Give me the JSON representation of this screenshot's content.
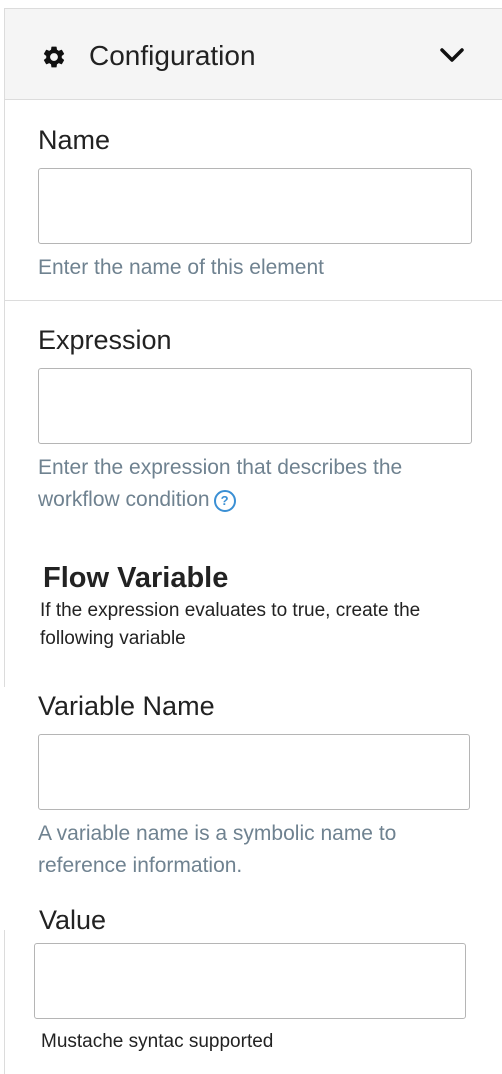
{
  "header": {
    "title": "Configuration"
  },
  "name_field": {
    "label": "Name",
    "help": "Enter the name of this element"
  },
  "expression_field": {
    "label": "Expression",
    "help": "Enter the expression that describes the workflow condition"
  },
  "flow_variable": {
    "title": "Flow Variable",
    "description": "If the expression evaluates to true, create the following variable"
  },
  "variable_name_field": {
    "label": "Variable Name",
    "help": "A variable name is a symbolic name to reference information."
  },
  "value_field": {
    "label": "Value",
    "note": "Mustache syntac supported"
  },
  "colors": {
    "accent": "#3a8fd4",
    "help_text": "#6f8290",
    "border": "#dcdcdc"
  },
  "icons": {
    "header": "gear-icon",
    "toggle": "chevron-down-icon",
    "help": "question-circle-icon"
  }
}
